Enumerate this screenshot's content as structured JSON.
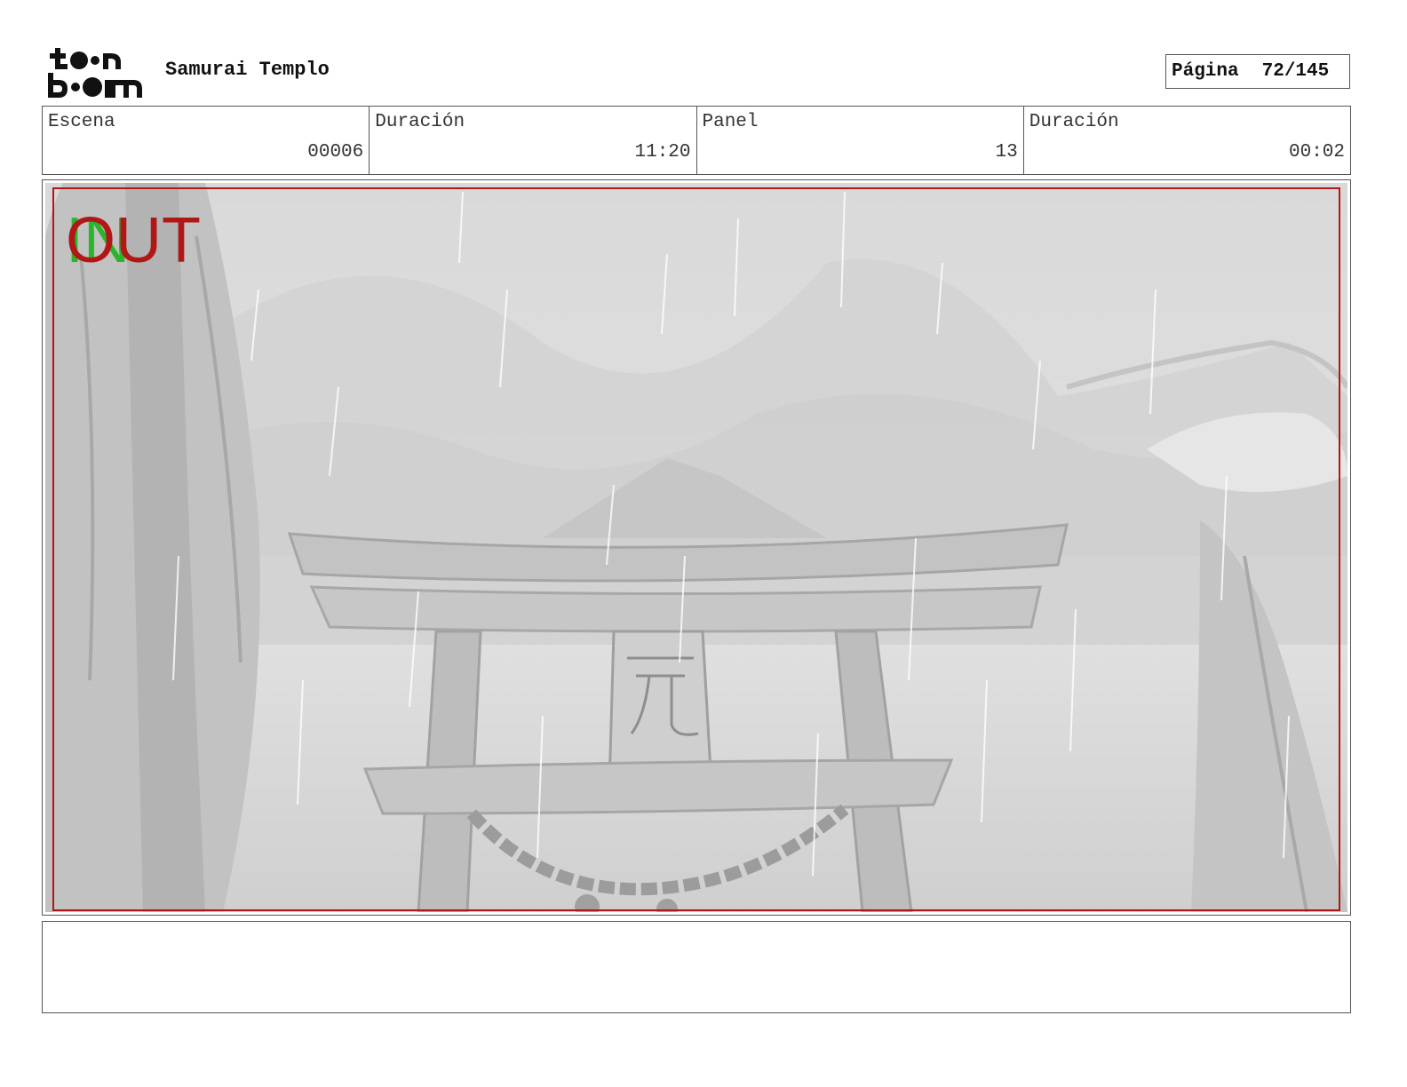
{
  "header": {
    "logo_text": "toon boom",
    "title": "Samurai Templo",
    "page_label": "Página",
    "page_number": "72/145"
  },
  "info": [
    {
      "label": "Escena",
      "value": "00006"
    },
    {
      "label": "Duración",
      "value": "11:20"
    },
    {
      "label": "Panel",
      "value": "13"
    },
    {
      "label": "Duración",
      "value": "00:02"
    }
  ],
  "panel": {
    "in_label": "IN",
    "out_label": "OUT",
    "description_colors": {
      "safe_frame": "#b01818",
      "in_marker": "#2bb52b",
      "out_marker": "#b01818"
    }
  },
  "notes": {
    "text": ""
  }
}
